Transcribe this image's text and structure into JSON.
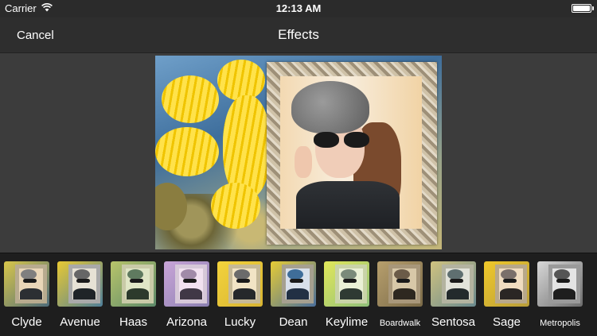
{
  "status_bar": {
    "carrier": "Carrier",
    "time": "12:13 AM",
    "battery_level": 1.0
  },
  "nav": {
    "cancel_label": "Cancel",
    "title": "Effects"
  },
  "icons": {
    "wifi": "wifi-icon",
    "battery": "battery-icon"
  },
  "effects": [
    {
      "label": "Clyde"
    },
    {
      "label": "Avenue"
    },
    {
      "label": "Haas"
    },
    {
      "label": "Arizona"
    },
    {
      "label": "Lucky"
    },
    {
      "label": "Dean"
    },
    {
      "label": "Keylime"
    },
    {
      "label": "Boardwalk"
    },
    {
      "label": "Sentosa"
    },
    {
      "label": "Sage"
    },
    {
      "label": "Metropolis"
    }
  ]
}
